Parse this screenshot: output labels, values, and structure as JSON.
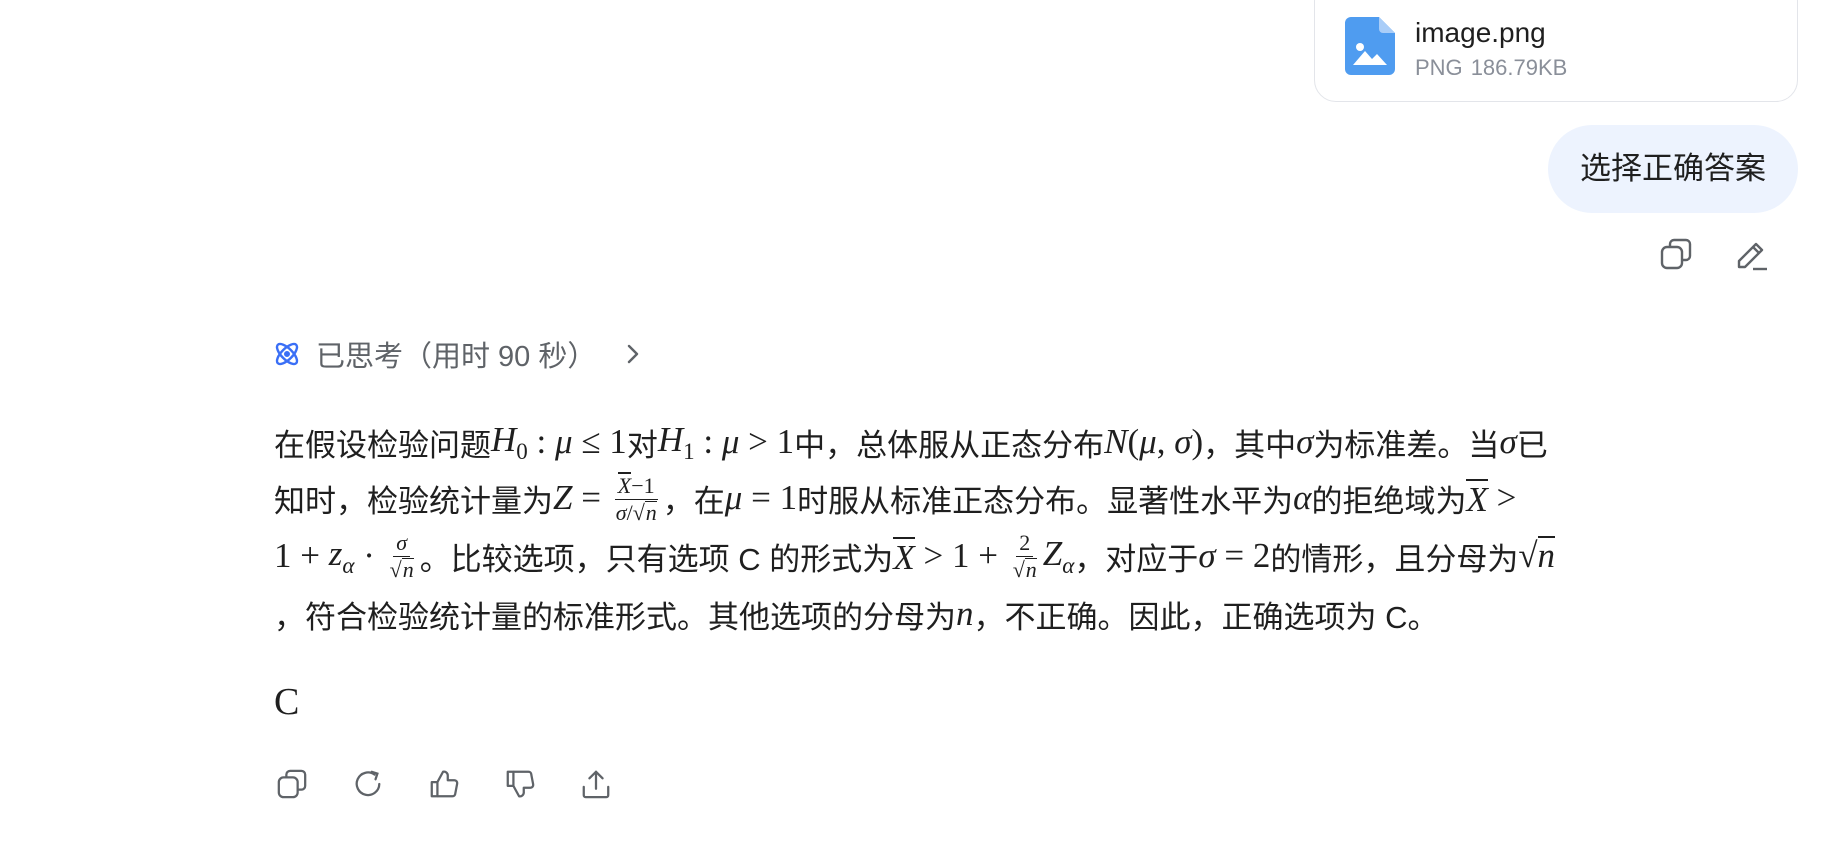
{
  "attachment": {
    "file_name": "image.png",
    "file_type": "PNG",
    "file_size": "186.79KB",
    "icon": "image-file-icon",
    "icon_color": "#4f9cf0"
  },
  "user_message": {
    "text": "选择正确答案",
    "bubble_color": "#edf3fe",
    "actions": [
      "copy-icon",
      "edit-icon"
    ]
  },
  "thinking": {
    "label": "已思考（用时 90 秒）",
    "icon": "atom-icon",
    "icon_color": "#3a6ff6"
  },
  "answer": {
    "l1": {
      "t1": "在假设检验问题 ",
      "t2": " 对 ",
      "t3": " 中，总体服从正态分布 ",
      "t4": "，其中 ",
      "t5": " 为标准差。当 ",
      "t6": " 已"
    },
    "l2": {
      "t1": "知时，检验统计量为 ",
      "t2": "，在 ",
      "t3": " 时服从标准正态分布。显著性水平为 ",
      "t4": " 的拒绝域为 "
    },
    "l3": {
      "t1": "。比较选项，只有选项 C 的形式为 ",
      "t2": "，对应于 ",
      "t3": " 的情形，且分母为 "
    },
    "l4": {
      "t1": "，符合检验统计量的标准形式。其他选项的分母为 ",
      "t2": "，不正确。因此，正确选项为 C。"
    },
    "final": "C"
  },
  "response_actions": [
    "copy-icon",
    "regenerate-icon",
    "thumbs-up-icon",
    "thumbs-down-icon",
    "share-icon"
  ]
}
